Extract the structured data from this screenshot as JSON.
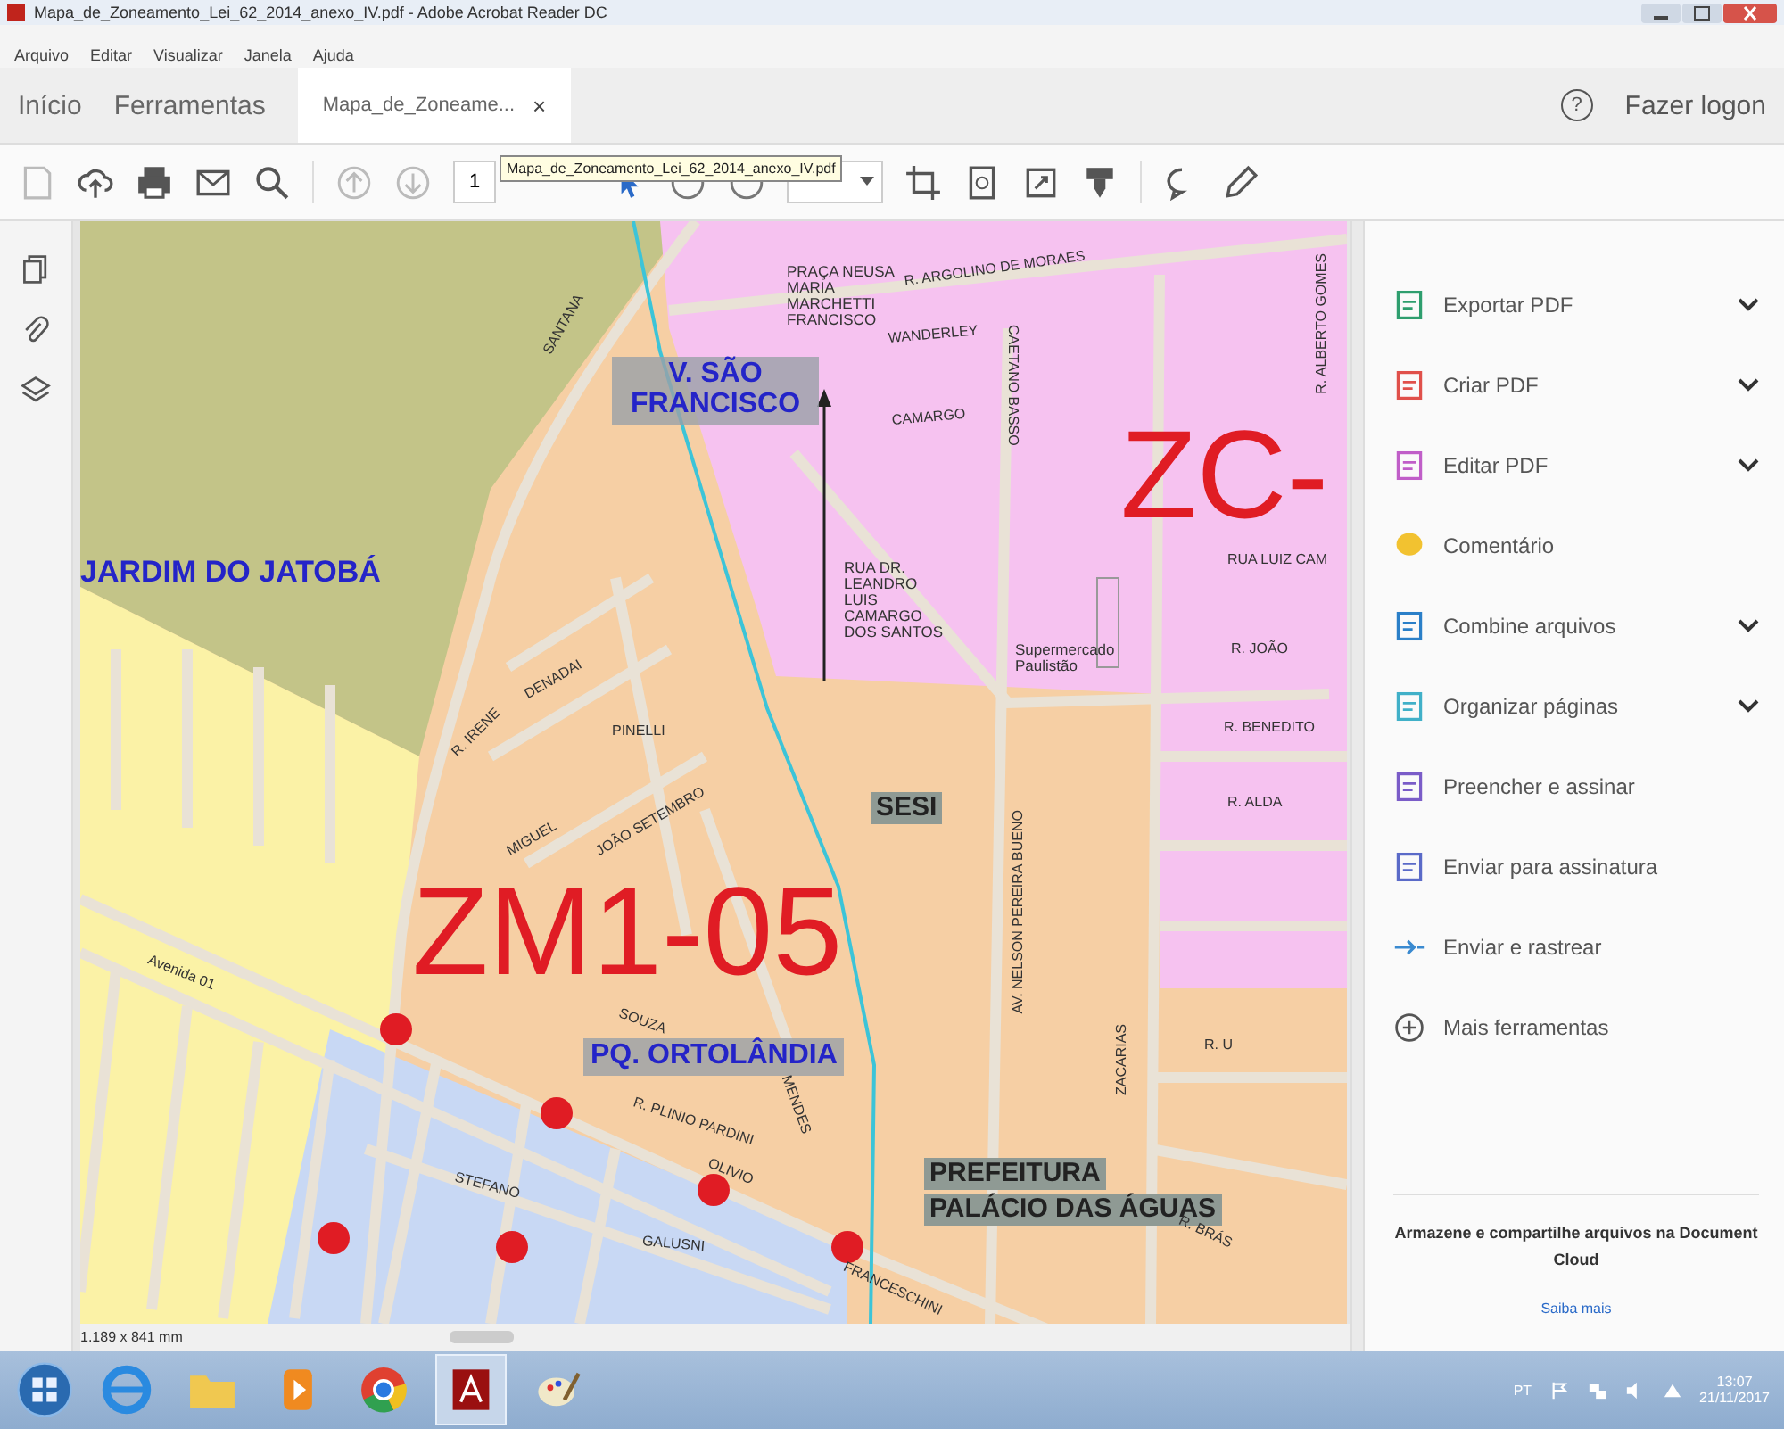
{
  "window": {
    "title": "Mapa_de_Zoneamento_Lei_62_2014_anexo_IV.pdf - Adobe Acrobat Reader DC"
  },
  "menu": [
    "Arquivo",
    "Editar",
    "Visualizar",
    "Janela",
    "Ajuda"
  ],
  "tabs": [
    {
      "label": "Início",
      "selected": false
    },
    {
      "label": "Ferramentas",
      "selected": false
    },
    {
      "label": "Mapa_de_Zoneame...",
      "selected": true,
      "close": "×"
    }
  ],
  "account": {
    "help": "?",
    "label": "Fazer logon"
  },
  "toolbar": {
    "page": "1",
    "tooltip": "Mapa_de_Zoneamento_Lei_62_2014_anexo_IV.pdf"
  },
  "map": {
    "labels": [
      {
        "kind": "area",
        "text": "JARDIM DO JATOBÁ"
      },
      {
        "kind": "district",
        "text": "V. SÃO FRANCISCO"
      },
      {
        "kind": "zone",
        "text": "ZC-"
      },
      {
        "kind": "zone",
        "text": "ZM1-05"
      },
      {
        "kind": "district",
        "text": "PQ. ORTOLÂNDIA"
      },
      {
        "kind": "landmark",
        "text": "SESI"
      },
      {
        "kind": "landmark",
        "text": "PREFEITURA"
      },
      {
        "kind": "landmark",
        "text": "PALÁCIO DAS ÁGUAS"
      },
      {
        "kind": "caption",
        "text": "PRAÇA NEUSA MARIA MARCHETTI FRANCISCO"
      },
      {
        "kind": "caption",
        "text": "RUA DR. LEANDRO LUIS CAMARGO DOS SANTOS"
      },
      {
        "kind": "caption",
        "text": "Supermercado Paulistão"
      },
      {
        "kind": "street",
        "text": "R. ARGOLINO DE MORAES"
      },
      {
        "kind": "street",
        "text": "WANDERLEY"
      },
      {
        "kind": "street",
        "text": "CAMARGO"
      },
      {
        "kind": "street",
        "text": "CAETANO BASSO"
      },
      {
        "kind": "street",
        "text": "RUA LUIZ CAM"
      },
      {
        "kind": "street",
        "text": "R. JOÃO"
      },
      {
        "kind": "street",
        "text": "R. BENEDITO"
      },
      {
        "kind": "street",
        "text": "R. ALDA"
      },
      {
        "kind": "street",
        "text": "R. U"
      },
      {
        "kind": "street",
        "text": "R. ALBERTO GOMES"
      },
      {
        "kind": "street",
        "text": "AV. NELSON PEREIRA BUENO"
      },
      {
        "kind": "street",
        "text": "SANTANA"
      },
      {
        "kind": "street",
        "text": "DENADAI"
      },
      {
        "kind": "street",
        "text": "R. IRENE"
      },
      {
        "kind": "street",
        "text": "PINELLI"
      },
      {
        "kind": "street",
        "text": "JOÃO SETEMBRO"
      },
      {
        "kind": "street",
        "text": "MIGUEL"
      },
      {
        "kind": "street",
        "text": "SOUZA"
      },
      {
        "kind": "street",
        "text": "Avenida 01"
      },
      {
        "kind": "street",
        "text": "R. PLINIO PARDINI"
      },
      {
        "kind": "street",
        "text": "STEFANO"
      },
      {
        "kind": "street",
        "text": "GALUSNI"
      },
      {
        "kind": "street",
        "text": "OLIVIO"
      },
      {
        "kind": "street",
        "text": "FRANCESCHINI"
      },
      {
        "kind": "street",
        "text": "ZACARIAS"
      },
      {
        "kind": "street",
        "text": "R. BRÁS"
      },
      {
        "kind": "street",
        "text": "MENDES"
      }
    ],
    "page_size": "1.189 x 841 mm"
  },
  "tools": [
    {
      "label": "Exportar PDF",
      "expandable": true,
      "color": "#2e9e6e"
    },
    {
      "label": "Criar PDF",
      "expandable": true,
      "color": "#e0504a"
    },
    {
      "label": "Editar PDF",
      "expandable": true,
      "color": "#c05ec8"
    },
    {
      "label": "Comentário",
      "expandable": false,
      "color": "#f2c230"
    },
    {
      "label": "Combine arquivos",
      "expandable": true,
      "color": "#2a7fc8"
    },
    {
      "label": "Organizar páginas",
      "expandable": true,
      "color": "#40b0c8"
    },
    {
      "label": "Preencher e assinar",
      "expandable": false,
      "color": "#7a5cc8"
    },
    {
      "label": "Enviar para assinatura",
      "expandable": false,
      "color": "#5a6ac8"
    },
    {
      "label": "Enviar e rastrear",
      "expandable": false,
      "color": "#3a8ad0"
    },
    {
      "label": "Mais ferramentas",
      "expandable": false,
      "color": "#555555"
    }
  ],
  "cloud_promo": {
    "text": "Armazene e compartilhe arquivos na Document Cloud",
    "link": "Saiba mais"
  },
  "taskbar": {
    "language": "PT",
    "time": "13:07",
    "date": "21/11/2017"
  }
}
